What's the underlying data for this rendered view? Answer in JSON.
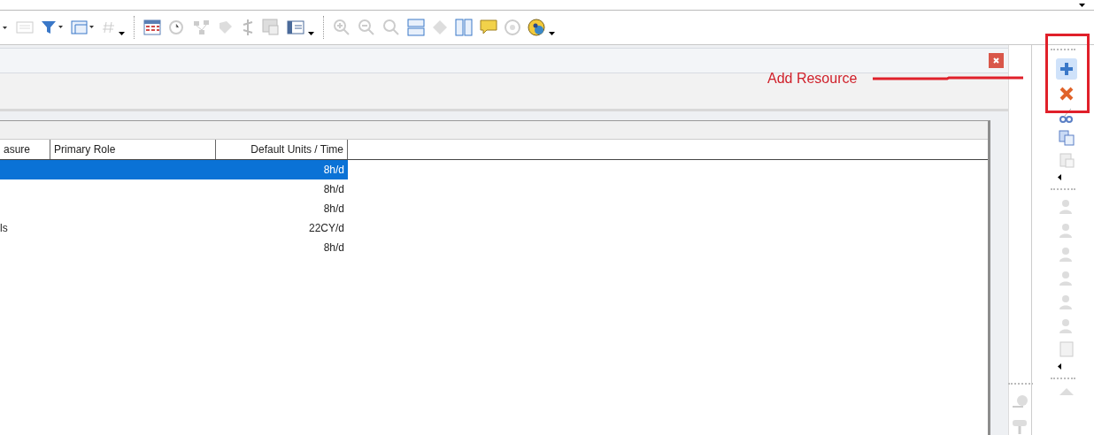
{
  "table": {
    "columns": [
      "asure",
      "Primary Role",
      "Default Units / Time"
    ],
    "rows": [
      {
        "units": "8h/d",
        "selected": true
      },
      {
        "units": "8h/d",
        "selected": false
      },
      {
        "units": "8h/d",
        "selected": false
      },
      {
        "column_1": "ls",
        "units": "22CY/d",
        "selected": false
      },
      {
        "units": "8h/d",
        "selected": false
      }
    ]
  },
  "annotation": {
    "label": "Add Resource"
  }
}
